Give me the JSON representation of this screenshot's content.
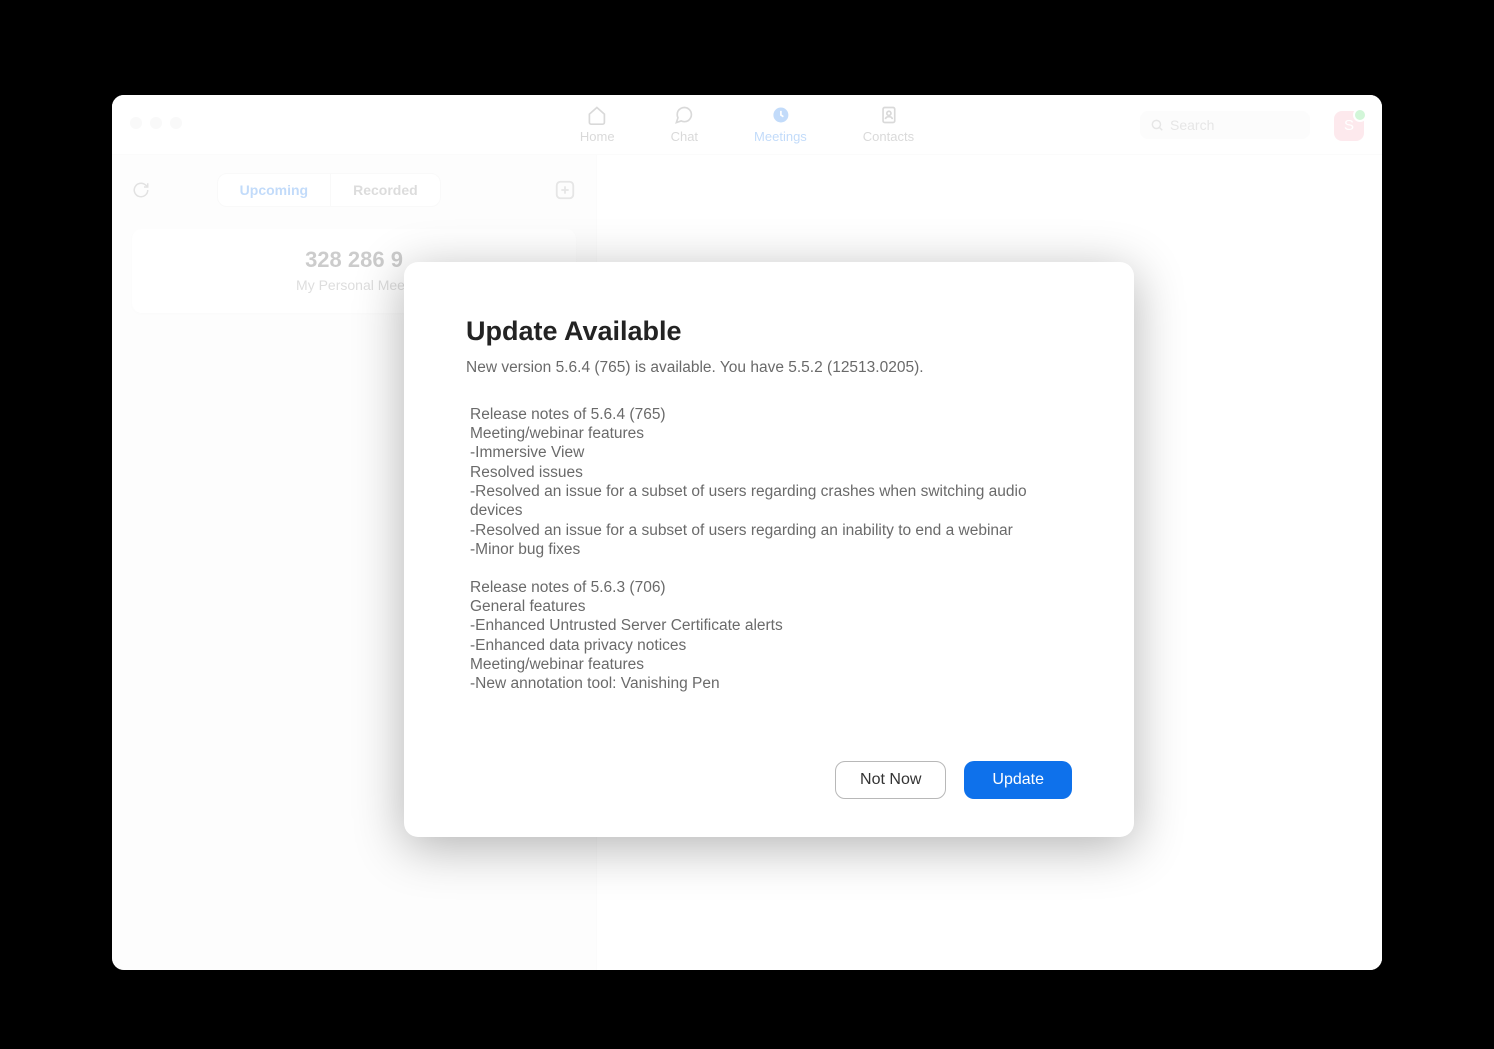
{
  "nav": {
    "home": "Home",
    "chat": "Chat",
    "meetings": "Meetings",
    "contacts": "Contacts"
  },
  "search": {
    "placeholder": "Search"
  },
  "avatar": {
    "initial": "S"
  },
  "sidebar": {
    "tabs": {
      "upcoming": "Upcoming",
      "recorded": "Recorded"
    },
    "meeting_id": "328 286 9",
    "meeting_subtitle": "My Personal Meeti"
  },
  "modal": {
    "title": "Update Available",
    "subtitle": "New version 5.6.4 (765) is available. You have 5.5.2 (12513.0205).",
    "release_notes": [
      "Release notes of 5.6.4 (765)",
      "Meeting/webinar features",
      "-Immersive View",
      "Resolved issues",
      "-Resolved an issue for a subset of users regarding crashes when switching audio devices",
      "-Resolved an issue for a subset of users regarding an inability to end a webinar",
      "-Minor bug fixes",
      "",
      "Release notes of 5.6.3 (706)",
      "General features",
      "-Enhanced Untrusted Server Certificate alerts",
      "-Enhanced data privacy notices",
      "Meeting/webinar features",
      "-New annotation tool: Vanishing Pen"
    ],
    "not_now_label": "Not Now",
    "update_label": "Update"
  }
}
